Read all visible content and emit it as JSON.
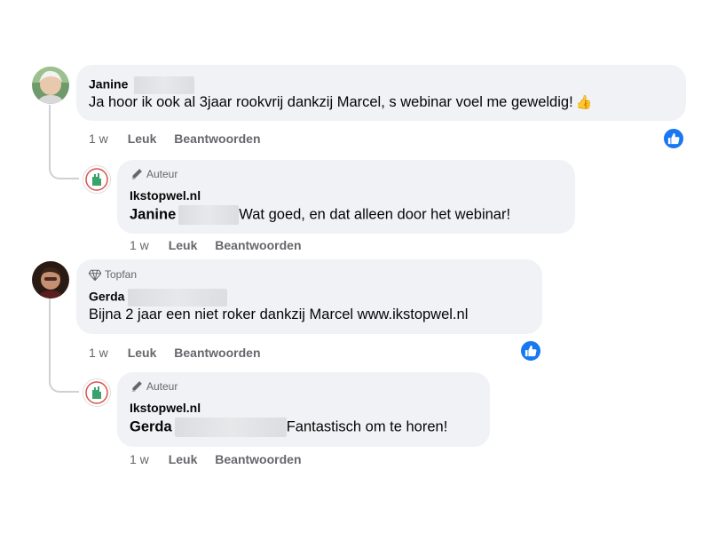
{
  "comments": [
    {
      "author": "Janine",
      "text": "Ja hoor ik ook al 3jaar rookvrij dankzij Marcel, s webinar voel me geweldig!",
      "emoji": "👍",
      "time": "1 w",
      "like_label": "Leuk",
      "reply_label": "Beantwoorden",
      "reaction_icon": "like-reaction-icon",
      "reply": {
        "badge": "Auteur",
        "author": "Ikstopwel.nl",
        "mention": "Janine",
        "text": "Wat goed, en dat alleen door het webinar!",
        "time": "1 w",
        "like_label": "Leuk",
        "reply_label": "Beantwoorden"
      }
    },
    {
      "badge": "Topfan",
      "author": "Gerda",
      "text": "Bijna 2 jaar een niet roker dankzij Marcel www.ikstopwel.nl",
      "time": "1 w",
      "like_label": "Leuk",
      "reply_label": "Beantwoorden",
      "reaction_icon": "like-reaction-icon",
      "reply": {
        "badge": "Auteur",
        "author": "Ikstopwel.nl",
        "mention": "Gerda",
        "text": "Fantastisch om te horen!",
        "time": "1 w",
        "like_label": "Leuk",
        "reply_label": "Beantwoorden"
      }
    }
  ],
  "colors": {
    "bubble": "#f0f2f5",
    "meta_text": "#65676b",
    "like_blue": "#1877f2",
    "thread_line": "#ced0d4"
  }
}
